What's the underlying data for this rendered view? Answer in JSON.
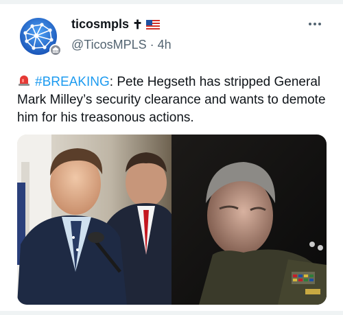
{
  "author": {
    "display_name": "ticosmpls",
    "name_emoji": "✝",
    "handle": "@TicosMPLS",
    "separator": "·",
    "time": "4h"
  },
  "tweet": {
    "siren_icon": "rotating-light-icon",
    "hashtag": "#BREAKING",
    "text": ": Pete Hegseth has stripped General Mark Milley’s security clearance and wants to demote him for his treasonous actions."
  },
  "icons": {
    "more": "more-horizontal-icon",
    "flag": "us-flag-icon",
    "verified_badge": "government-badge-icon"
  },
  "colors": {
    "accent": "#1d9bf0",
    "text": "#0f1419",
    "secondary": "#536471"
  }
}
